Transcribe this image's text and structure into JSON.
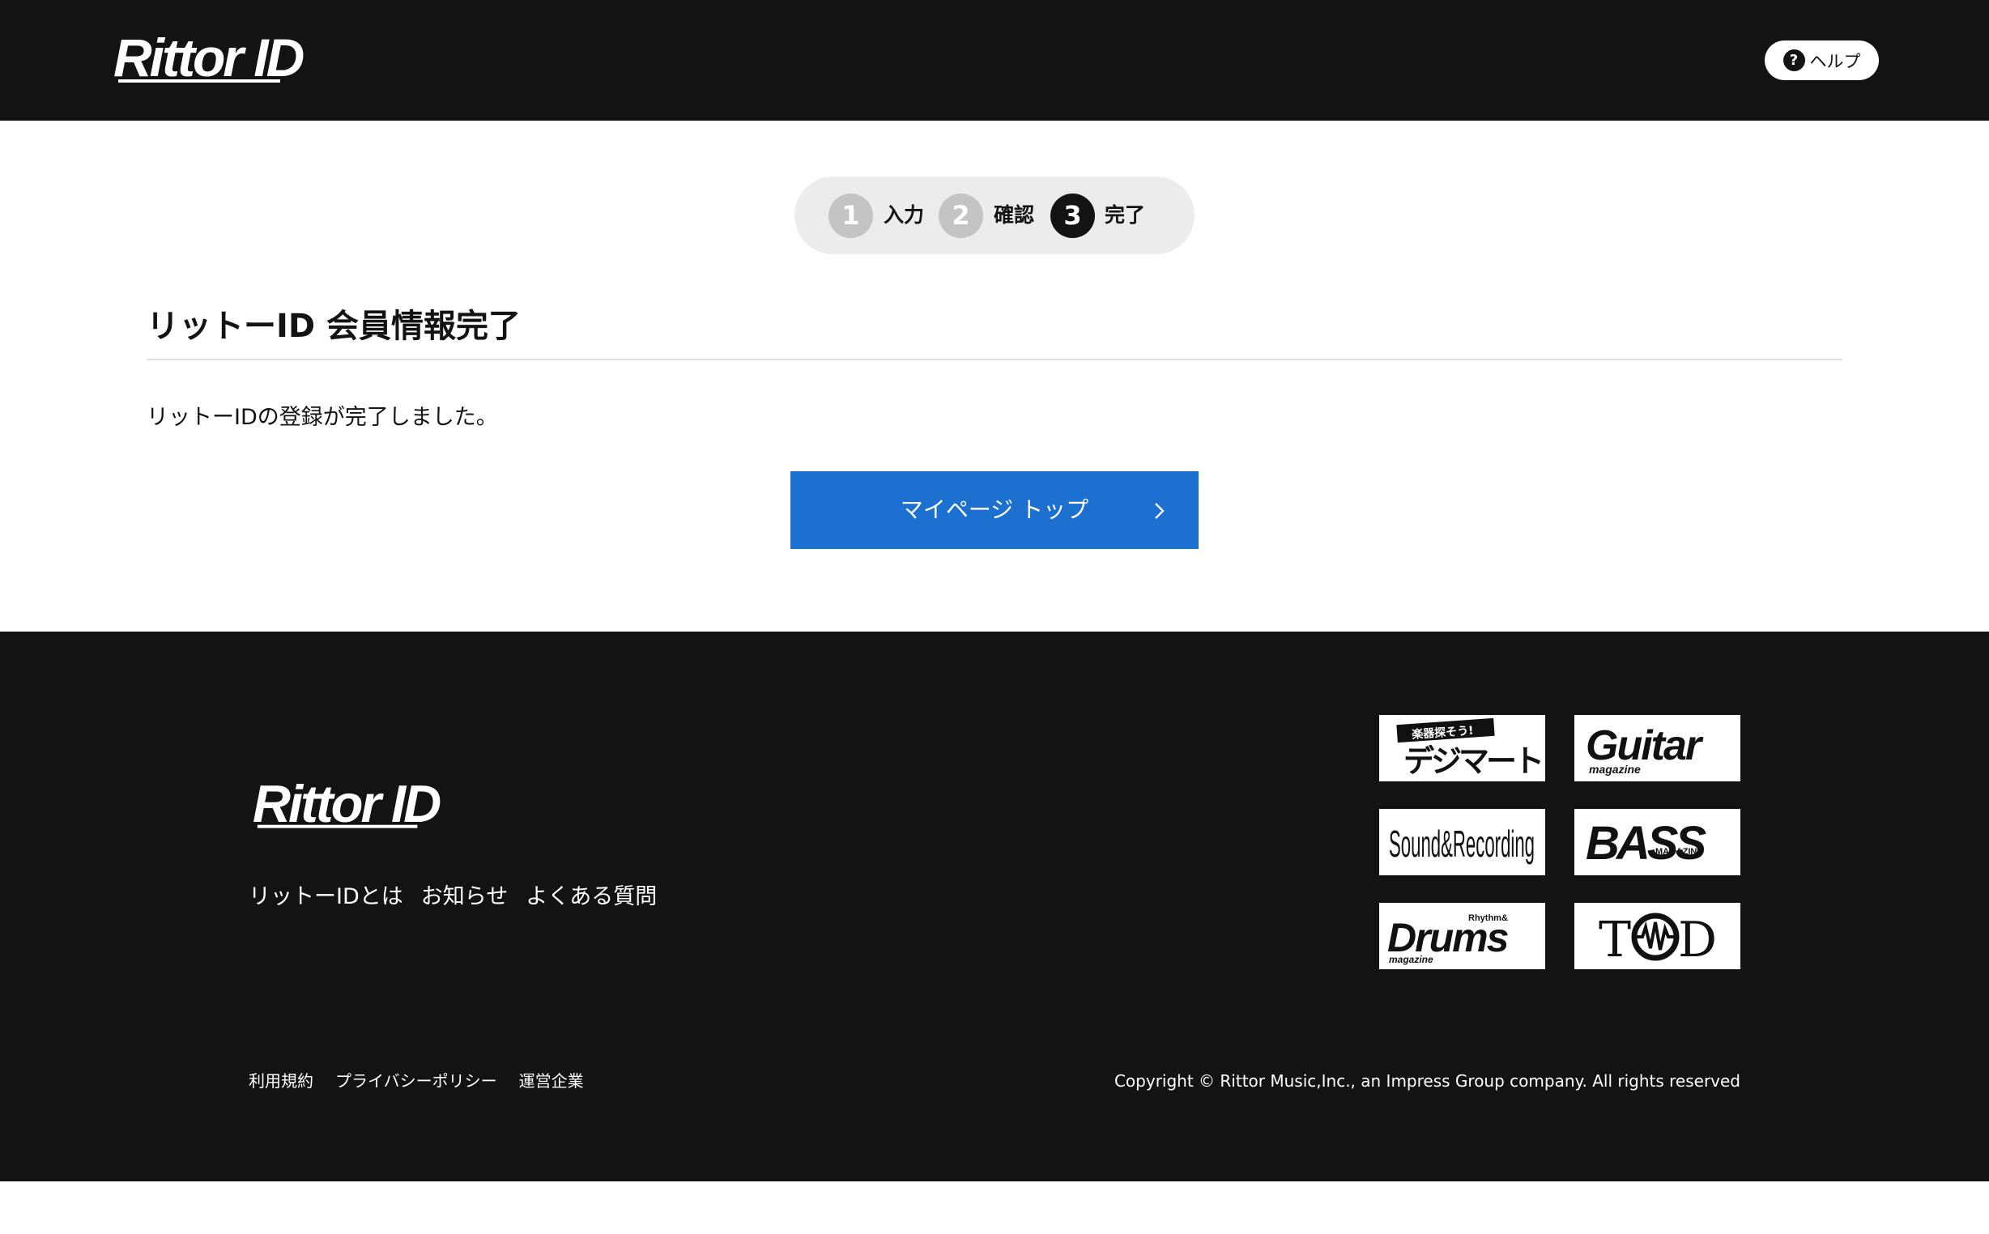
{
  "header": {
    "logo_text": "Rittor ID",
    "help_icon": "?",
    "help_label": "ヘルプ"
  },
  "stepper": {
    "steps": [
      {
        "number": "1",
        "label": "入力",
        "state": "done"
      },
      {
        "number": "2",
        "label": "確認",
        "state": "done"
      },
      {
        "number": "3",
        "label": "完了",
        "state": "current"
      }
    ]
  },
  "main": {
    "title": "リットーID 会員情報完了",
    "message": "リットーIDの登録が完了しました。",
    "button_label": "マイページ トップ",
    "button_icon": "chevron-right-icon"
  },
  "footer": {
    "logo_text": "Rittor ID",
    "nav": [
      "リットーIDとは",
      "お知らせ",
      "よくある質問"
    ],
    "brands": [
      {
        "name": "楽器探そう! デジマート",
        "lines": [
          "楽器探そう!",
          "デジマート"
        ]
      },
      {
        "name": "Guitar magazine",
        "lines": [
          "Guitar",
          "magazine"
        ]
      },
      {
        "name": "Sound & Recording",
        "lines": [
          "Sound&Recording"
        ]
      },
      {
        "name": "BASS MAGAZINE",
        "lines": [
          "BASS",
          "MAGAZINE"
        ]
      },
      {
        "name": "Rhythm & Drums magazine",
        "lines": [
          "Rhythm&",
          "Drums",
          "magazine"
        ]
      },
      {
        "name": "TOD",
        "lines": [
          "T",
          "D"
        ]
      }
    ],
    "legal": [
      "利用規約",
      "プライバシーポリシー",
      "運営企業"
    ],
    "copyright": "Copyright © Rittor Music,Inc., an Impress Group company. All rights reserved"
  },
  "colors": {
    "header_bg": "#131313",
    "accent_button": "#1b70d0",
    "step_inactive": "#c4c4c4",
    "step_active": "#131313",
    "stepper_bg": "#ececec"
  }
}
